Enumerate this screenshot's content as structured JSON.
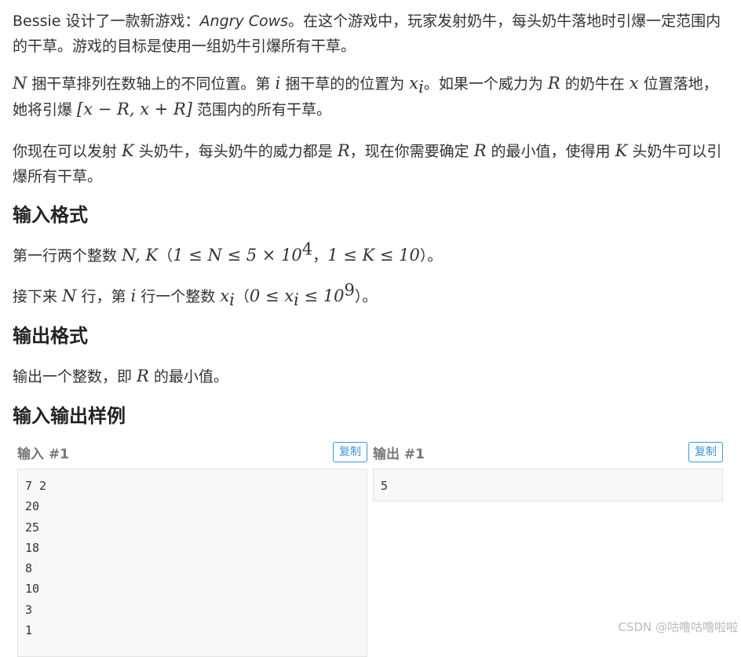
{
  "problem": {
    "p1": {
      "name": "Bessie",
      "t1": " 设计了一款新游戏：",
      "game": "Angry Cows",
      "t2": "。在这个游戏中，玩家发射奶牛，每头奶牛落地时引爆一定范围内的干草。游戏的目标是使用一组奶牛引爆所有干草。"
    },
    "p2": {
      "N": "N",
      "t1": " 捆干草排列在数轴上的不同位置。第 ",
      "i": "i",
      "t2": " 捆干草的的位置为 ",
      "x": "x",
      "xsub": "i",
      "t3": "。如果一个威力为 ",
      "R": "R",
      "t4": " 的奶牛在 ",
      "x2": "x",
      "t5": " 位置落地，她将引爆 ",
      "range": "[x − R, x + R]",
      "t6": " 范围内的所有干草。"
    },
    "p3": {
      "t1": "你现在可以发射 ",
      "K": "K",
      "t2": " 头奶牛，每头奶牛的威力都是 ",
      "R": "R",
      "t3": "，现在你需要确定 ",
      "R2": "R",
      "t4": " 的最小值，使得用 ",
      "K2": "K",
      "t5": " 头奶牛可以引爆所有干草。"
    }
  },
  "input_format": {
    "heading": "输入格式",
    "l1": {
      "t1": "第一行两个整数 ",
      "NK": "N, K",
      "t2": "（",
      "c1": "1 ≤ N ≤ 5 × 10",
      "exp1": "4",
      "t3": "，",
      "c2": "1 ≤ K ≤ 10",
      "t4": "）。"
    },
    "l2": {
      "t1": "接下来 ",
      "N": "N",
      "t2": " 行，第 ",
      "i": "i",
      "t3": " 行一个整数 ",
      "x": "x",
      "xsub": "i",
      "t4": "（",
      "c1": "0 ≤ x",
      "c1sub": "i",
      "c2": " ≤ 10",
      "exp": "9",
      "t5": "）。"
    }
  },
  "output_format": {
    "heading": "输出格式",
    "t1": "输出一个整数，即 ",
    "R": "R",
    "t2": " 的最小值。"
  },
  "samples": {
    "heading": "输入输出样例",
    "input": {
      "title": "输入 #1",
      "copy_label": "复制",
      "lines": [
        "7 2",
        "20",
        "25",
        "18",
        "8",
        "10",
        "3",
        "1"
      ]
    },
    "output": {
      "title": "输出 #1",
      "copy_label": "复制",
      "lines": [
        "5"
      ]
    }
  },
  "watermark": "CSDN @咕噜咕噜啦啦",
  "colors": {
    "copy_button": "#3498db",
    "code_bg": "#f8f8f8",
    "text": "#333333"
  }
}
